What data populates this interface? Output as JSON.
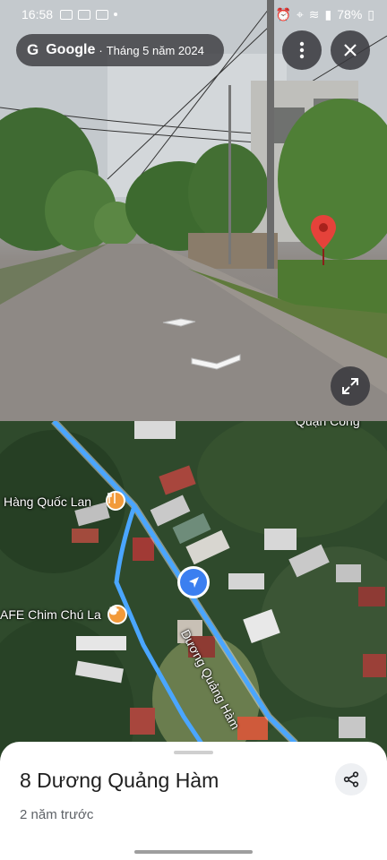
{
  "statusbar": {
    "time": "16:58",
    "battery": "78%"
  },
  "header": {
    "logo_letter": "G",
    "brand": "Google",
    "separator": "·",
    "capture_date": "Tháng 5 năm 2024"
  },
  "icons": {
    "more": "more-vertical-icon",
    "close": "close-icon",
    "expand": "expand-icon",
    "share": "share-icon",
    "pin": "red-location-pin-icon",
    "user": "navigation-arrow-icon",
    "restaurant": "fork-knife-icon",
    "cafe": "coffee-cup-icon"
  },
  "map": {
    "labels": {
      "top_right": "Quận Công",
      "restaurant": "Hàng Quốc Lan",
      "cafe": "AFE Chim Chú La",
      "street": "Dương Quảng Hàm"
    }
  },
  "sheet": {
    "title": "8 Dương Quảng Hàm",
    "subtitle": "2 năm trước"
  },
  "colors": {
    "route": "#4aa6ff",
    "user_dot": "#3b7ff0",
    "poi": "#f29a3b",
    "pin": "#e5423a"
  }
}
